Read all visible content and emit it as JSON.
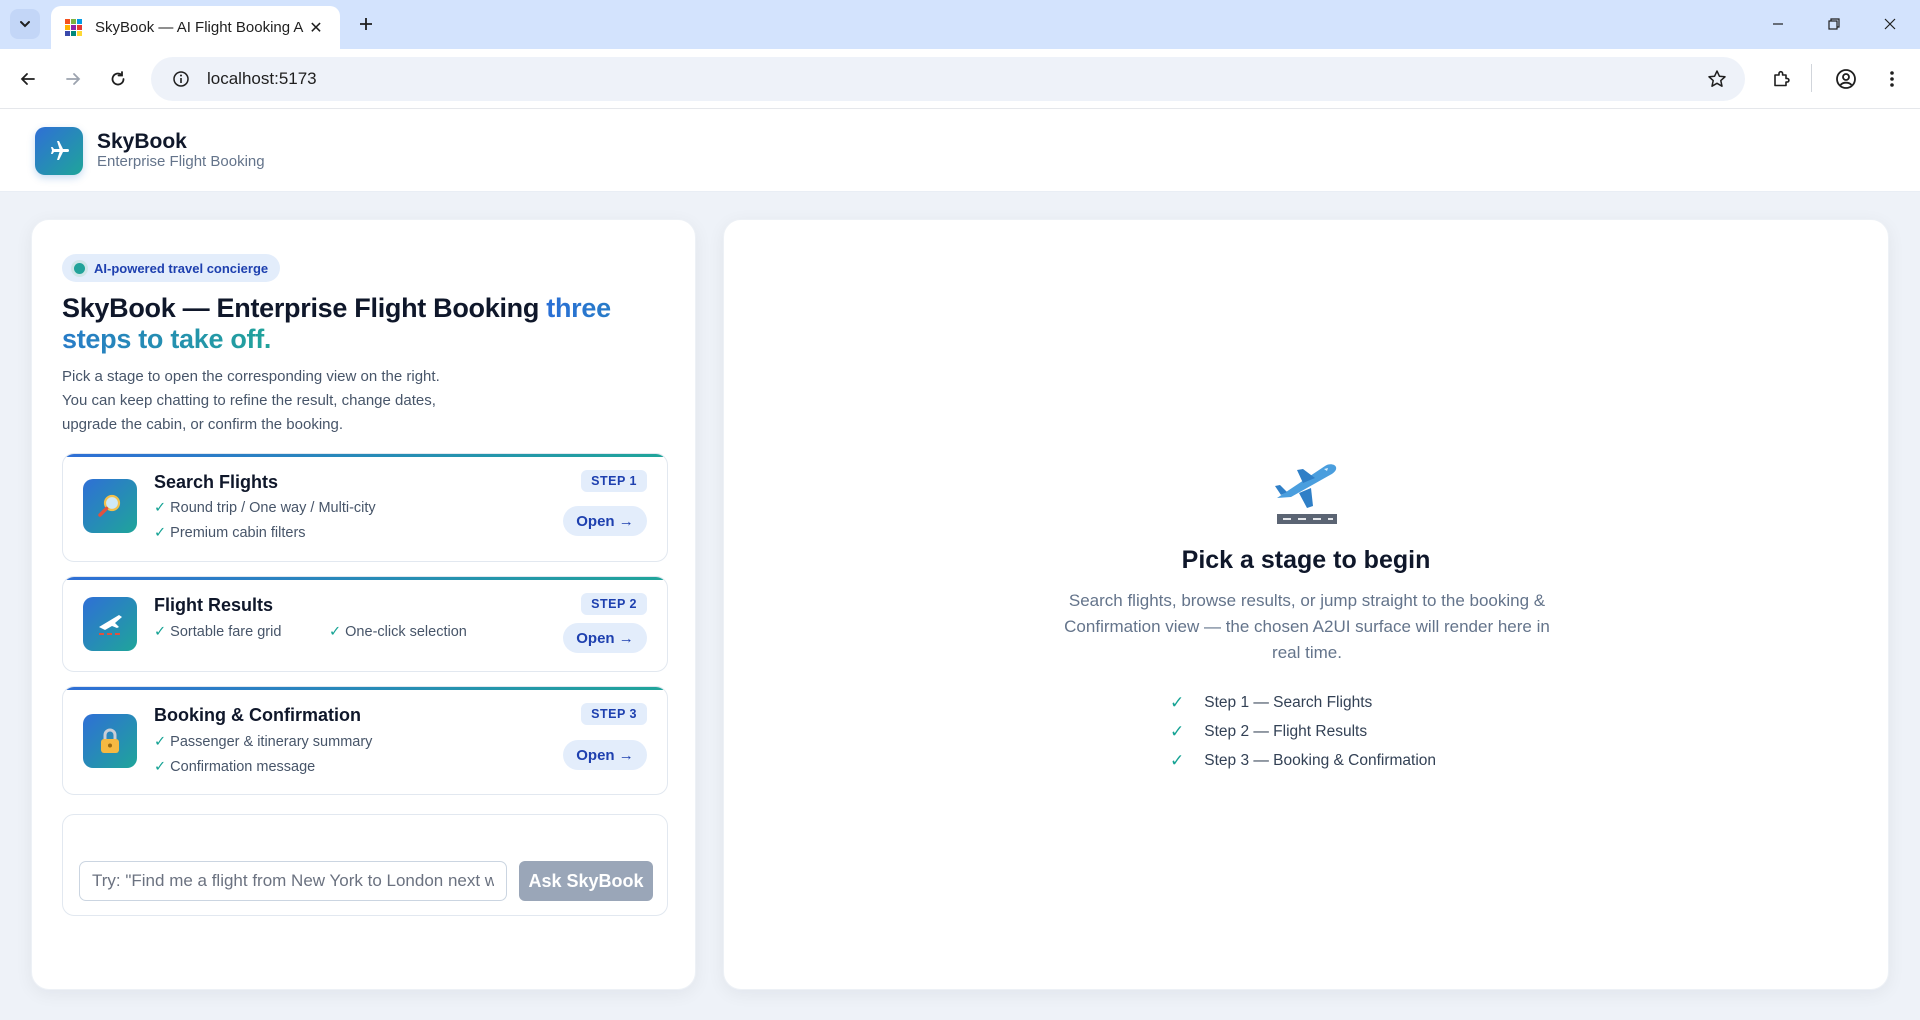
{
  "browser": {
    "tab_title": "SkyBook — AI Flight Booking A",
    "url": "localhost:5173"
  },
  "header": {
    "brand_name": "SkyBook",
    "brand_sub": "Enterprise Flight Booking"
  },
  "left": {
    "pill": "AI-powered travel concierge",
    "hero_main": "SkyBook — Enterprise Flight Booking ",
    "hero_accent": "three steps to take off.",
    "intro_1": "Pick a stage to open the corresponding view on the right.",
    "intro_2": "You can keep chatting to refine the result, change dates,",
    "intro_3": "upgrade the cabin, or confirm the booking.",
    "steps": [
      {
        "title": "Search Flights",
        "badge": "STEP 1",
        "features": [
          "Round trip / One way / Multi-city",
          "Premium cabin filters"
        ],
        "open": "Open →",
        "icon": "magnifier-icon"
      },
      {
        "title": "Flight Results",
        "badge": "STEP 2",
        "features": [
          "Sortable fare grid",
          "One-click selection"
        ],
        "open": "Open →",
        "icon": "airplane-departure-icon"
      },
      {
        "title": "Booking & Confirmation",
        "badge": "STEP 3",
        "features": [
          "Passenger & itinerary summary",
          "Confirmation message"
        ],
        "open": "Open →",
        "icon": "lock-icon"
      }
    ],
    "chat": {
      "placeholder": "Try: \"Find me a flight from New York to London next week\"",
      "button": "Ask SkyBook"
    }
  },
  "right": {
    "empty_title": "Pick a stage to begin",
    "empty_desc": "Search flights, browse results, or jump straight to the booking & Confirmation view — the chosen A2UI surface will render here in real time.",
    "checklist": [
      "Step 1 — Search Flights",
      "Step 2 — Flight Results",
      "Step 3 — Booking & Confirmation"
    ]
  },
  "colors": {
    "brand_blue": "#2f6fd6",
    "brand_teal": "#1fa59a",
    "accent_bg": "#e3edfb"
  }
}
